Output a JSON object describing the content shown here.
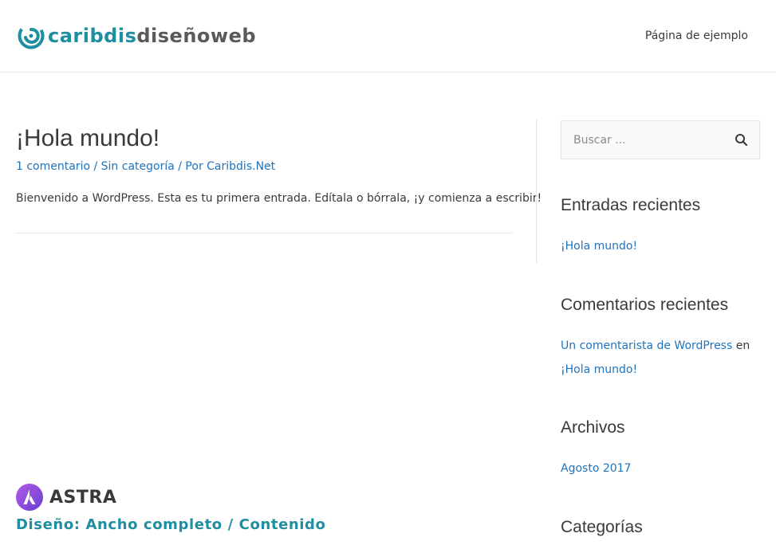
{
  "header": {
    "logo": {
      "part1": "caribdis",
      "part2": "diseñoweb"
    },
    "nav": {
      "sample_page": "Página de ejemplo"
    }
  },
  "post": {
    "title": "¡Hola mundo!",
    "meta": {
      "comments": "1 comentario",
      "separator1": " / ",
      "category": "Sin categoría",
      "separator2": " / Por ",
      "author": "Caribdis.Net"
    },
    "content": "Bienvenido a WordPress. Esta es tu primera entrada. Edítala o bórrala, ¡y comienza a escribir!"
  },
  "sidebar": {
    "search": {
      "placeholder": "Buscar ..."
    },
    "recent_posts": {
      "title": "Entradas recientes",
      "items": [
        "¡Hola mundo!"
      ]
    },
    "recent_comments": {
      "title": "Comentarios recientes",
      "author": "Un comentarista de WordPress",
      "connector": " en",
      "post": "¡Hola mundo!"
    },
    "archives": {
      "title": "Archivos",
      "items": [
        "Agosto 2017"
      ]
    },
    "categories": {
      "title": "Categorías"
    }
  },
  "badge": {
    "name": "ASTRA",
    "caption": "Diseño: Ancho completo / Contenido"
  },
  "colors": {
    "brand_teal": "#1e8ea0",
    "link_blue": "#1e73be",
    "text": "#3a3a3a",
    "astra_purple": "#8a4bd6"
  }
}
